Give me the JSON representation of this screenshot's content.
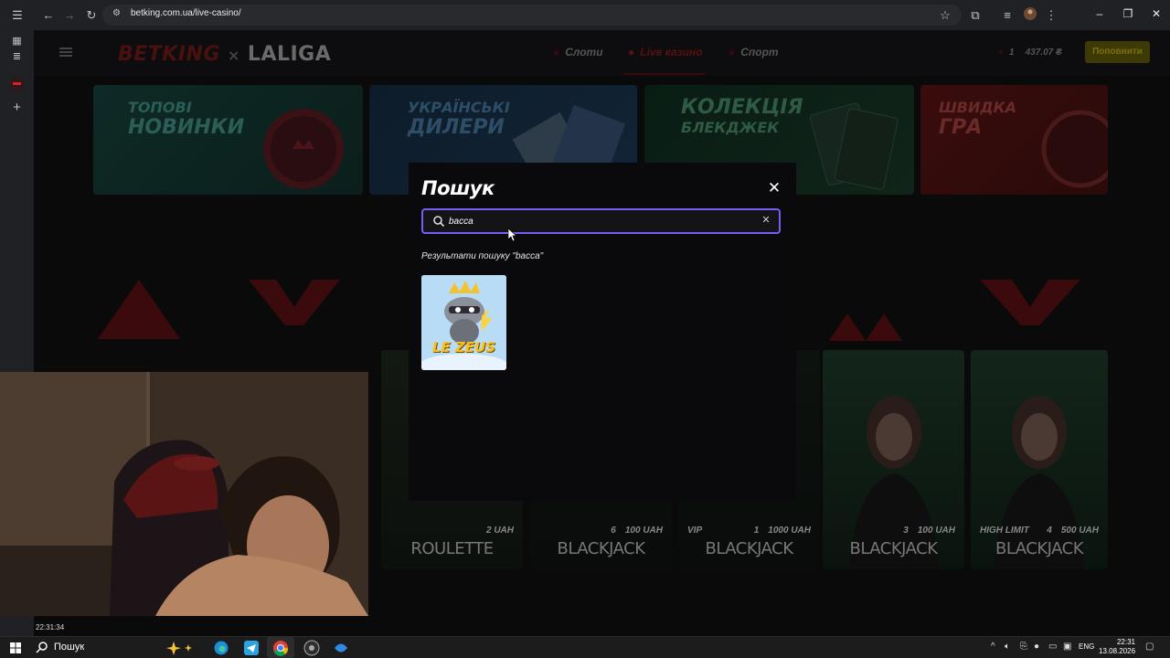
{
  "browser": {
    "url": "betking.com.ua/live-casino/"
  },
  "site": {
    "logo": "BETKING",
    "partner": "LALIGA",
    "nav": [
      {
        "label": "Слоти"
      },
      {
        "label": "Live казино"
      },
      {
        "label": "Спорт"
      }
    ],
    "balance_count": "1",
    "balance": "437.07 ₴",
    "topup_label": "Поповнити",
    "categories": [
      {
        "line1": "ТОПОВІ",
        "line2": "НОВИНКИ"
      },
      {
        "line1": "УКРАЇНСЬКІ",
        "line2": "ДИЛЕРИ"
      },
      {
        "line1": "КОЛЕКЦІЯ",
        "line2": "БЛЕКДЖЕК"
      },
      {
        "line1": "ШВИДКА",
        "line2": "ГРА"
      }
    ],
    "live_tables": [
      {
        "name": "ROULETTE",
        "stake": "2 UAH",
        "badge": ""
      },
      {
        "name": "BLACKJACK",
        "stake": "100 UAH",
        "badge": "6"
      },
      {
        "name": "BLACKJACK",
        "stake": "1000 UAH",
        "badge": "1",
        "prefix": "VIP"
      },
      {
        "name": "BLACKJACK",
        "stake": "100 UAH",
        "badge": "3"
      },
      {
        "name": "BLACKJACK",
        "stake": "500 UAH",
        "badge": "4",
        "prefix": "HIGH LIMIT"
      }
    ]
  },
  "search_modal": {
    "title": "Пошук",
    "query": "bacca",
    "results_label": "Результати пошуку \"bacca\"",
    "results": [
      {
        "title": "LE ZEUS"
      }
    ]
  },
  "webcam": {
    "timestamp": "22:31:34"
  },
  "taskbar": {
    "search_label": "Пошук",
    "language": "ENG",
    "time": "22:31",
    "date": "13.08.2026"
  }
}
